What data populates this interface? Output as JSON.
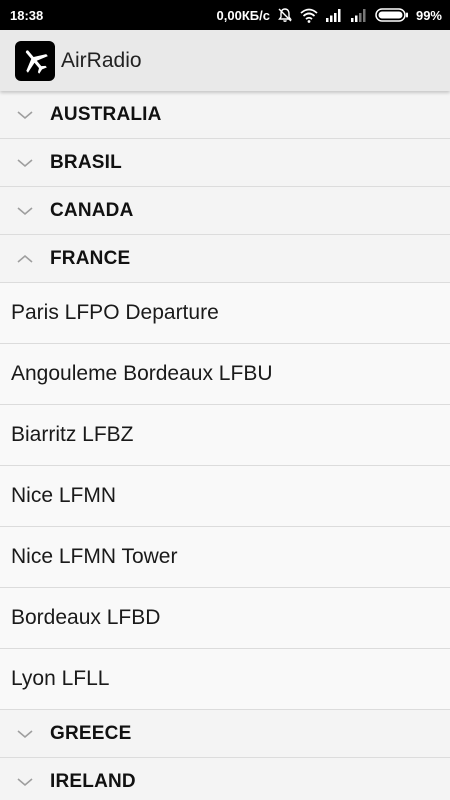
{
  "status_bar": {
    "time": "18:38",
    "speed": "0,00КБ/с",
    "battery": "99%",
    "icons": [
      "alarm-off-icon",
      "wifi-icon",
      "signal-icon",
      "signal-icon",
      "battery-icon"
    ]
  },
  "app_bar": {
    "title": "AirRadio",
    "icon": "airplane-icon"
  },
  "countries": {
    "australia": {
      "label": "AUSTRALIA",
      "expanded": false
    },
    "brasil": {
      "label": "BRASIL",
      "expanded": false
    },
    "canada": {
      "label": "CANADA",
      "expanded": false
    },
    "france": {
      "label": "FRANCE",
      "expanded": true,
      "stations": [
        "Paris LFPO Departure",
        "Angouleme Bordeaux LFBU",
        "Biarritz LFBZ",
        "Nice LFMN",
        "Nice LFMN Tower",
        "Bordeaux LFBD",
        "Lyon LFLL"
      ]
    },
    "greece": {
      "label": "GREECE",
      "expanded": false
    },
    "ireland": {
      "label": "IRELAND",
      "expanded": false
    }
  },
  "colors": {
    "app_bar_bg": "#e9e9e9",
    "status_bar_bg": "#000000",
    "chevron": "#9e9e9e"
  }
}
